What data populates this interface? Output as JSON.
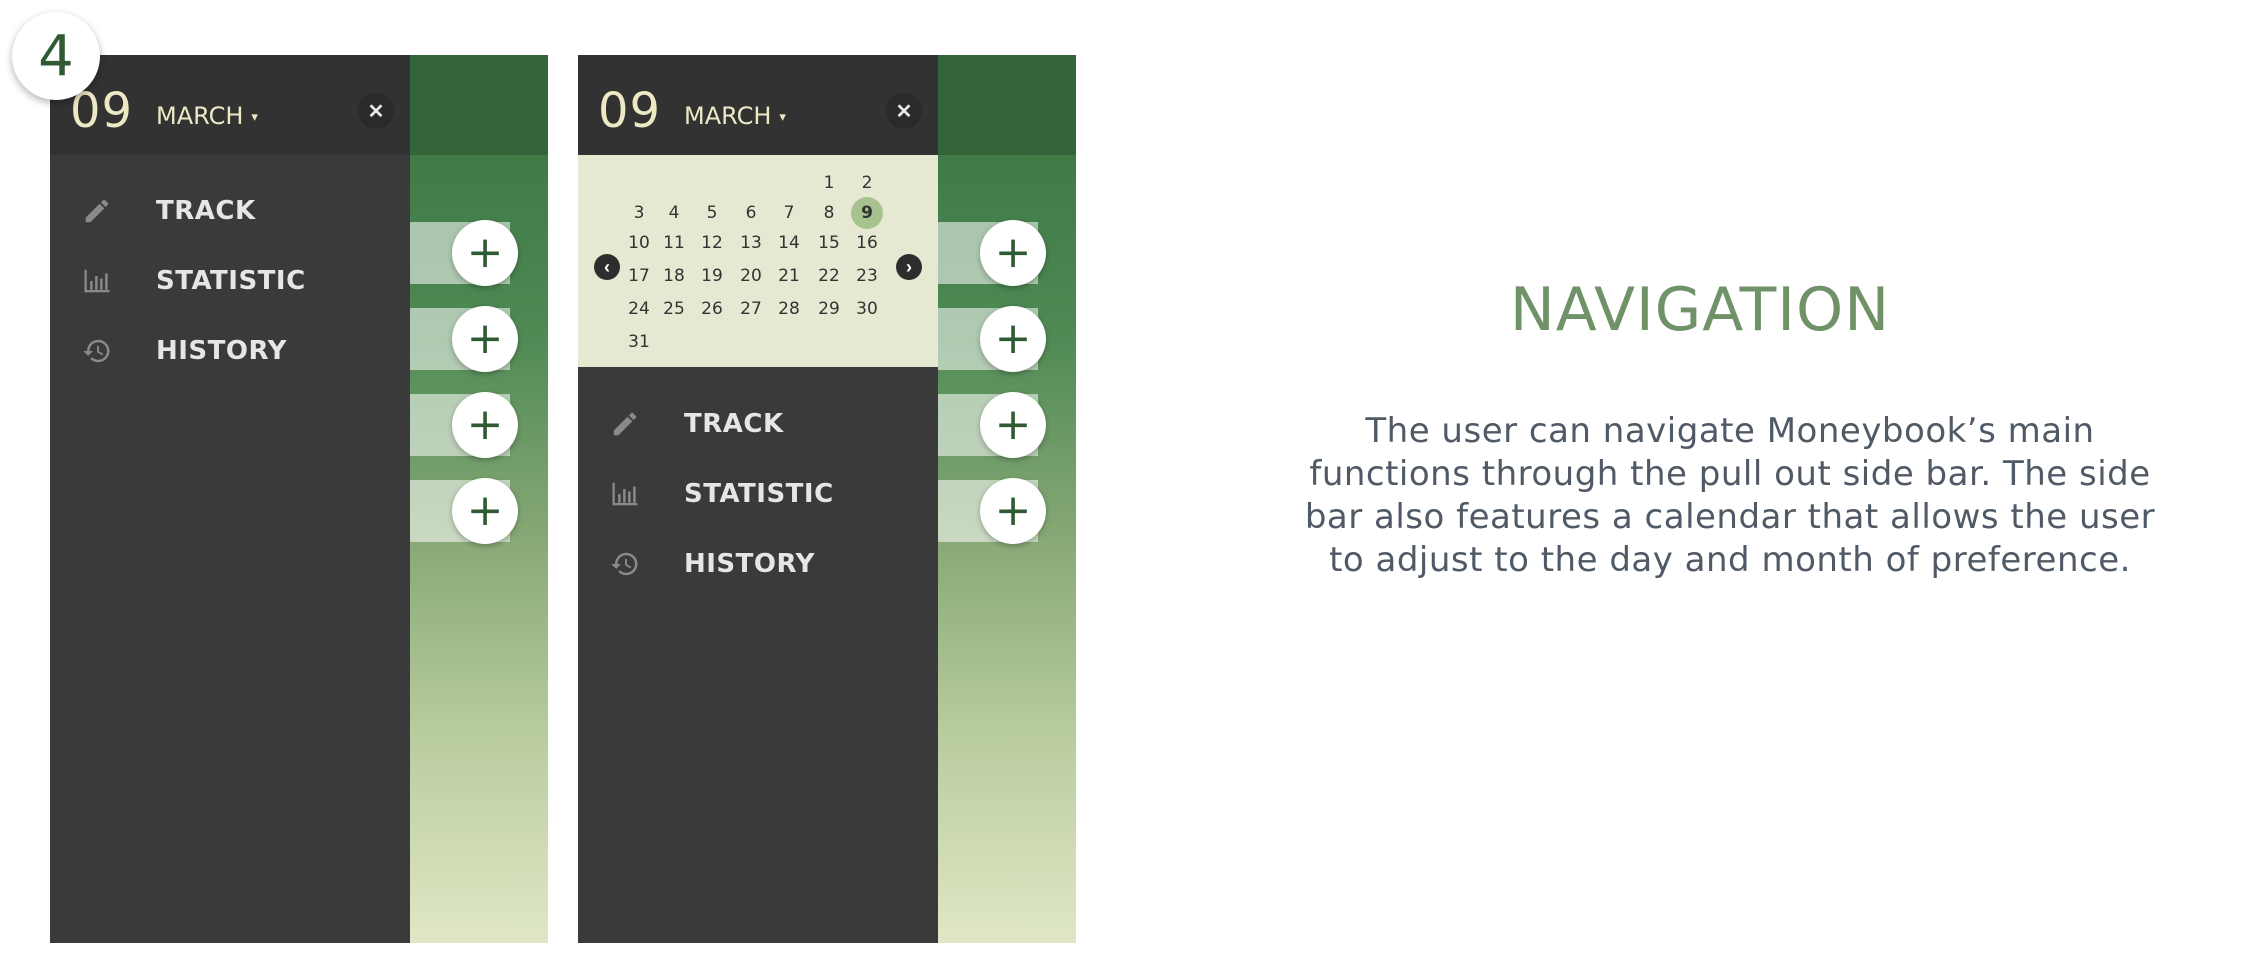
{
  "step_number": "4",
  "screens": [
    {
      "header": {
        "day": "09",
        "month": "MARCH",
        "caret": "▾",
        "close": "✕"
      },
      "menu": [
        {
          "label": "TRACK",
          "icon": "pencil-icon"
        },
        {
          "label": "STATISTIC",
          "icon": "bar-chart-icon"
        },
        {
          "label": "HISTORY",
          "icon": "history-icon"
        }
      ],
      "add_buttons": [
        "+",
        "+",
        "+",
        "+"
      ]
    },
    {
      "header": {
        "day": "09",
        "month": "MARCH",
        "caret": "▾",
        "close": "✕"
      },
      "calendar": {
        "days": [
          "1",
          "2",
          "3",
          "4",
          "5",
          "6",
          "7",
          "8",
          "9",
          "10",
          "11",
          "12",
          "13",
          "14",
          "15",
          "16",
          "17",
          "18",
          "19",
          "20",
          "21",
          "22",
          "23",
          "24",
          "25",
          "26",
          "27",
          "28",
          "29",
          "30",
          "31"
        ],
        "selected": "9",
        "prev": "‹",
        "next": "›"
      },
      "menu": [
        {
          "label": "TRACK",
          "icon": "pencil-icon"
        },
        {
          "label": "STATISTIC",
          "icon": "bar-chart-icon"
        },
        {
          "label": "HISTORY",
          "icon": "history-icon"
        }
      ],
      "add_buttons": [
        "+",
        "+",
        "+",
        "+"
      ]
    }
  ],
  "section": {
    "title": "NAVIGATION",
    "description": "The user can navigate Moneybook’s main functions  through the pull out side bar.  The side bar also features a calendar that allows the user to adjust to the day and month of preference."
  },
  "colors": {
    "drawer_bg": "#3a3a3a",
    "header_bg": "#323232",
    "calendar_bg": "#e6e8d2",
    "accent_green": "#2f5a33",
    "selected_day": "#a7c28f",
    "title_green": "#6f9268"
  }
}
